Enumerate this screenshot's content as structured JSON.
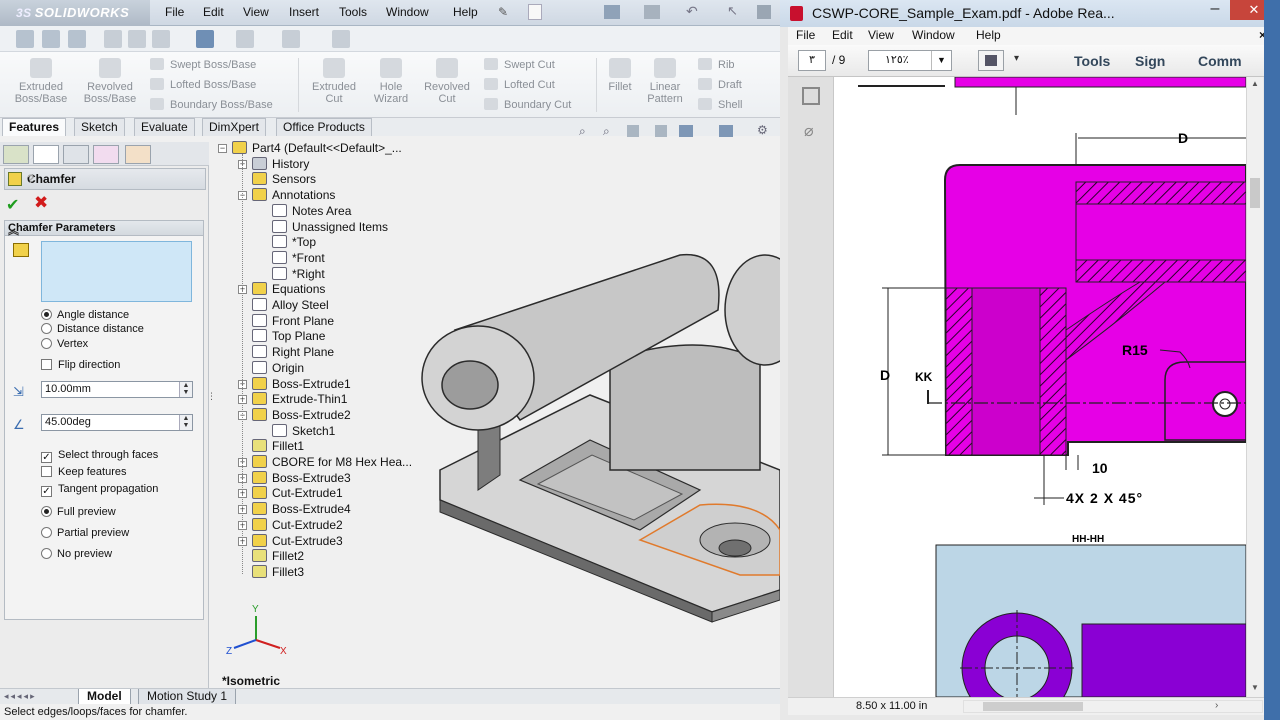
{
  "solidworks": {
    "app_name": "SOLIDWORKS",
    "brand_prefix": "3S",
    "menu": [
      "File",
      "Edit",
      "View",
      "Insert",
      "Tools",
      "Window",
      "Help"
    ],
    "command_manager": {
      "big": [
        {
          "label": "Extruded\nBoss/Base"
        },
        {
          "label": "Revolved\nBoss/Base"
        },
        {
          "label": "Extruded\nCut"
        },
        {
          "label": "Hole\nWizard"
        },
        {
          "label": "Revolved\nCut"
        },
        {
          "label": "Fillet"
        },
        {
          "label": "Linear\nPattern"
        }
      ],
      "small": [
        "Swept Boss/Base",
        "Lofted Boss/Base",
        "Boundary Boss/Base",
        "Swept Cut",
        "Lofted Cut",
        "Boundary Cut",
        "Rib",
        "Draft",
        "Shell"
      ]
    },
    "tabs": [
      "Features",
      "Sketch",
      "Evaluate",
      "DimXpert",
      "Office Products"
    ],
    "active_tab": "Features",
    "property_manager": {
      "title": "Chamfer",
      "help": "?",
      "group_title": "Chamfer Parameters",
      "chamfer_type_options": [
        "Angle distance",
        "Distance distance",
        "Vertex"
      ],
      "selected_type": "Angle distance",
      "flip_direction": "Flip direction",
      "distance_value": "10.00mm",
      "angle_value": "45.00deg",
      "checkboxes": [
        {
          "label": "Select through faces",
          "checked": true
        },
        {
          "label": "Keep features",
          "checked": false
        },
        {
          "label": "Tangent propagation",
          "checked": true
        }
      ],
      "preview_options": [
        "Full preview",
        "Partial preview",
        "No preview"
      ],
      "selected_preview": "Full preview"
    },
    "feature_tree": [
      {
        "label": "Part4  (Default<<Default>_...",
        "icon": "part-icon",
        "level": 0,
        "expander": "-"
      },
      {
        "label": "History",
        "icon": "history-icon",
        "level": 1,
        "expander": "+"
      },
      {
        "label": "Sensors",
        "icon": "sensors-icon",
        "level": 1,
        "expander": ""
      },
      {
        "label": "Annotations",
        "icon": "annotations-icon",
        "level": 1,
        "expander": "-"
      },
      {
        "label": "Notes Area",
        "icon": "note-icon",
        "level": 2,
        "expander": ""
      },
      {
        "label": "Unassigned Items",
        "icon": "note-icon",
        "level": 2,
        "expander": ""
      },
      {
        "label": "*Top",
        "icon": "note-icon",
        "level": 2,
        "expander": ""
      },
      {
        "label": "*Front",
        "icon": "note-icon",
        "level": 2,
        "expander": ""
      },
      {
        "label": "*Right",
        "icon": "note-icon",
        "level": 2,
        "expander": ""
      },
      {
        "label": "Equations",
        "icon": "equations-icon",
        "level": 1,
        "expander": "+"
      },
      {
        "label": "Alloy Steel",
        "icon": "material-icon",
        "level": 1,
        "expander": ""
      },
      {
        "label": "Front Plane",
        "icon": "plane-icon",
        "level": 1,
        "expander": ""
      },
      {
        "label": "Top Plane",
        "icon": "plane-icon",
        "level": 1,
        "expander": ""
      },
      {
        "label": "Right Plane",
        "icon": "plane-icon",
        "level": 1,
        "expander": ""
      },
      {
        "label": "Origin",
        "icon": "origin-icon",
        "level": 1,
        "expander": ""
      },
      {
        "label": "Boss-Extrude1",
        "icon": "extrude-icon",
        "level": 1,
        "expander": "+"
      },
      {
        "label": "Extrude-Thin1",
        "icon": "extrude-icon",
        "level": 1,
        "expander": "+"
      },
      {
        "label": "Boss-Extrude2",
        "icon": "extrude-icon",
        "level": 1,
        "expander": "-"
      },
      {
        "label": "Sketch1",
        "icon": "sketch-icon",
        "level": 2,
        "expander": ""
      },
      {
        "label": "Fillet1",
        "icon": "fillet-icon",
        "level": 1,
        "expander": ""
      },
      {
        "label": "CBORE for M8 Hex Hea...",
        "icon": "hole-icon",
        "level": 1,
        "expander": "+"
      },
      {
        "label": "Boss-Extrude3",
        "icon": "extrude-icon",
        "level": 1,
        "expander": "+"
      },
      {
        "label": "Cut-Extrude1",
        "icon": "cut-icon",
        "level": 1,
        "expander": "+"
      },
      {
        "label": "Boss-Extrude4",
        "icon": "extrude-icon",
        "level": 1,
        "expander": "+"
      },
      {
        "label": "Cut-Extrude2",
        "icon": "cut-icon",
        "level": 1,
        "expander": "+"
      },
      {
        "label": "Cut-Extrude3",
        "icon": "cut-icon",
        "level": 1,
        "expander": "+"
      },
      {
        "label": "Fillet2",
        "icon": "fillet-icon",
        "level": 1,
        "expander": ""
      },
      {
        "label": "Fillet3",
        "icon": "fillet-icon",
        "level": 1,
        "expander": ""
      }
    ],
    "view_label": "*Isometric",
    "triad": {
      "x": "X",
      "y": "Y",
      "z": "Z"
    },
    "bottom_tabs": [
      "Model",
      "Motion Study 1"
    ],
    "status_text": "Select edges/loops/faces for chamfer.",
    "colors": {
      "model_face": "#c9c9c9",
      "model_edge": "#2b2b2b",
      "preview": "#e07a2c",
      "selection_box": "#cfe7f7"
    }
  },
  "reader": {
    "title": "CSWP-CORE_Sample_Exam.pdf - Adobe Rea...",
    "menu": [
      "File",
      "Edit",
      "View",
      "Window",
      "Help"
    ],
    "close_x": "×",
    "page_current": "٣",
    "page_total": "/ 9",
    "zoom": "١٢٥٪",
    "tools": [
      "Tools",
      "Sign",
      "Comm"
    ],
    "page_size": "8.50 x 11.00 in",
    "drawing": {
      "dims": [
        "D",
        "D",
        "KK",
        "R15",
        "10",
        "4X 2 X 45°"
      ],
      "section_label": "HH-HH",
      "magenta": "#e600e6",
      "section_bg": "#bcd6e6",
      "purple": "#8a00d4"
    }
  }
}
